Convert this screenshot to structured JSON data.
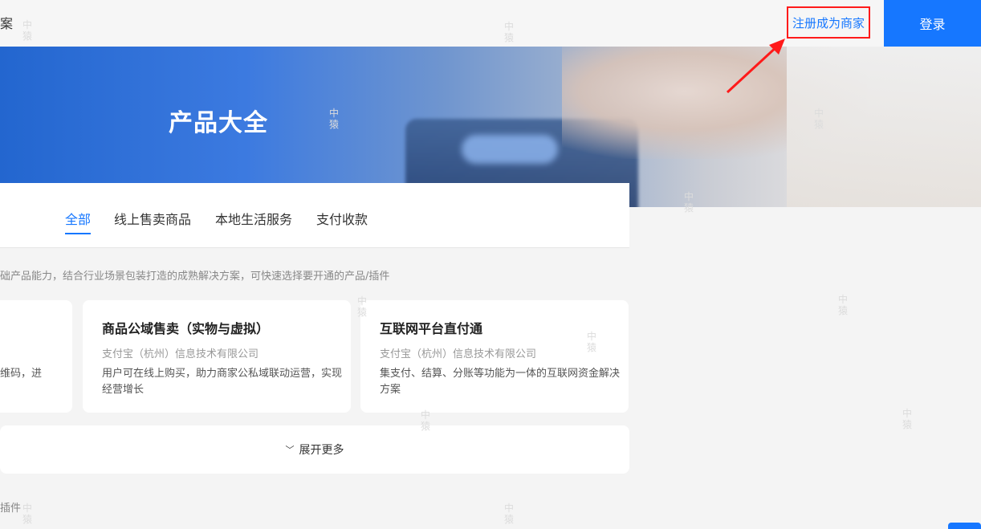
{
  "header": {
    "left_fragment": "案",
    "register_label": "注册成为商家",
    "login_label": "登录"
  },
  "banner": {
    "title": "产品大全"
  },
  "tabs": [
    {
      "label": "全部",
      "active": true
    },
    {
      "label": "线上售卖商品",
      "active": false
    },
    {
      "label": "本地生活服务",
      "active": false
    },
    {
      "label": "支付收款",
      "active": false
    }
  ],
  "description": "础产品能力，结合行业场景包装打造的成熟解决方案，可快速选择要开通的产品/插件",
  "cards": [
    {
      "title": "",
      "company": "",
      "text": "维码，进"
    },
    {
      "title": "商品公域售卖（实物与虚拟）",
      "company": "支付宝（杭州）信息技术有限公司",
      "text": "用户可在线上购买，助力商家公私域联动运营，实现经营增长"
    },
    {
      "title": "互联网平台直付通",
      "company": "支付宝（杭州）信息技术有限公司",
      "text": "集支付、结算、分账等功能为一体的互联网资金解决方案"
    }
  ],
  "more": {
    "label": "展开更多",
    "icon": "double-chevron-down-icon"
  },
  "bottom_fragment": "插件",
  "watermark_text": "中\n猿",
  "colors": {
    "accent": "#1677ff",
    "highlight_box": "#ff1a1a",
    "background": "#f4f4f4"
  }
}
